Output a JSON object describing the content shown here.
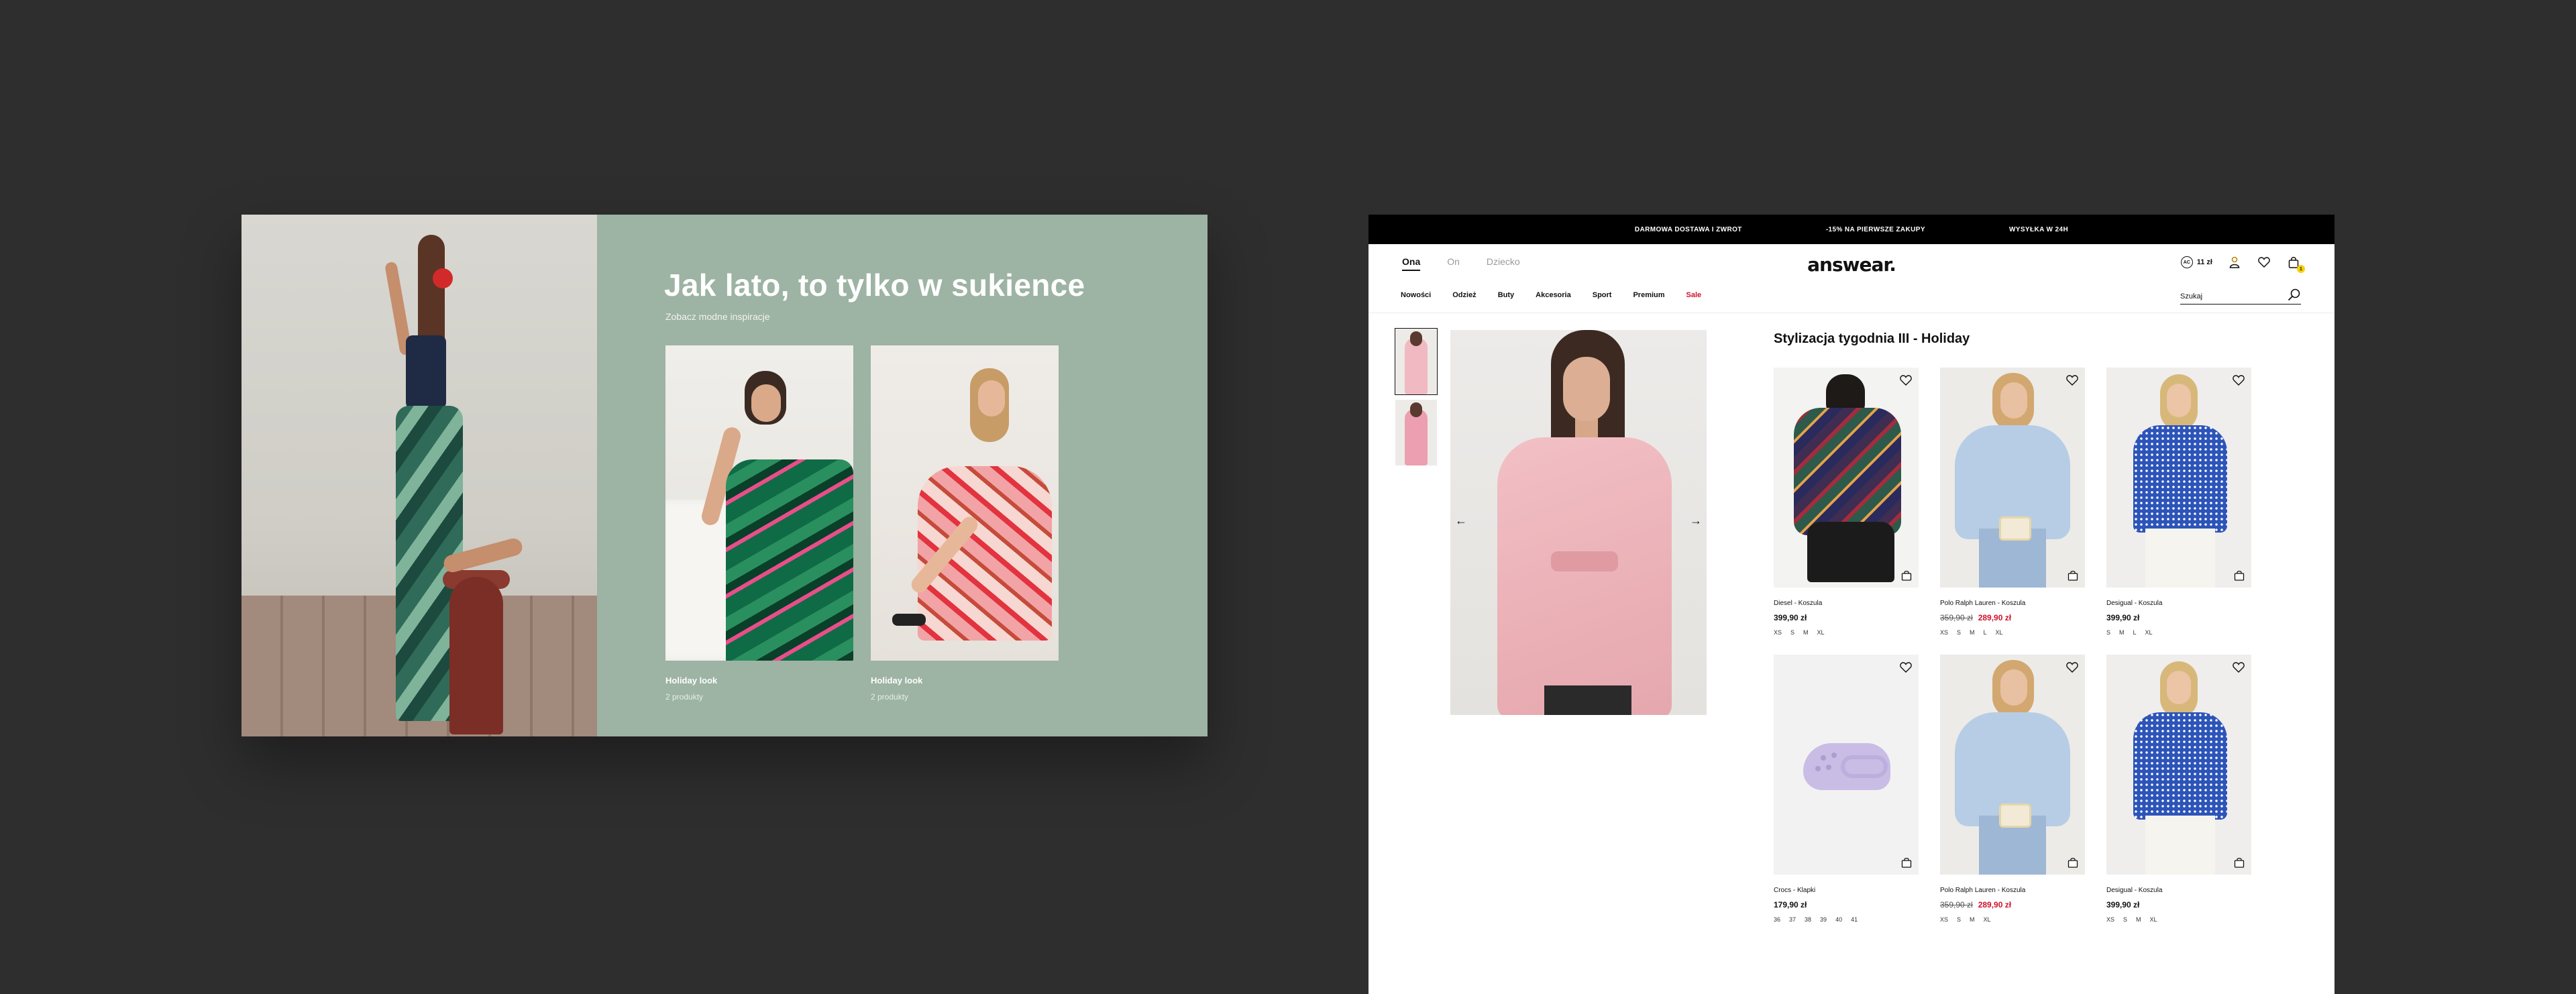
{
  "promo": {
    "title": "Jak lato, to tylko w sukience",
    "subtitle": "Zobacz modne inspiracje",
    "looks": [
      {
        "name": "Holiday look",
        "count": "2 produkty"
      },
      {
        "name": "Holiday look",
        "count": "2 produkty"
      }
    ],
    "background_color": "#9db3a3"
  },
  "shop": {
    "topbar": [
      "DARMOWA DOSTAWA I ZWROT",
      "-15% NA PIERWSZE ZAKUPY",
      "WYSYŁKA W 24H"
    ],
    "gender_tabs": [
      "Ona",
      "On",
      "Dziecko"
    ],
    "active_gender": "Ona",
    "logo": "answear.",
    "points": {
      "badge": "AC",
      "value": "11 zł"
    },
    "cart_count": "1",
    "nav": [
      "Nowości",
      "Odzież",
      "Buty",
      "Akcesoria",
      "Sport",
      "Premium",
      "Sale"
    ],
    "search": {
      "placeholder": "Szukaj"
    },
    "section_title": "Stylizacja tygodnia III - Holiday",
    "products": [
      {
        "brand": "Diesel - Koszula",
        "price": "399,90 zł",
        "old_price": "",
        "sizes": [
          "XS",
          "S",
          "M",
          "XL"
        ]
      },
      {
        "brand": "Polo Ralph Lauren - Koszula",
        "price": "289,90 zł",
        "old_price": "359,90 zł",
        "sizes": [
          "XS",
          "S",
          "M",
          "L",
          "XL"
        ]
      },
      {
        "brand": "Desigual - Koszula",
        "price": "399,90 zł",
        "old_price": "",
        "sizes": [
          "S",
          "M",
          "L",
          "XL"
        ]
      },
      {
        "brand": "Crocs - Klapki",
        "price": "179,90 zł",
        "old_price": "",
        "sizes": [
          "36",
          "37",
          "38",
          "39",
          "40",
          "41"
        ]
      },
      {
        "brand": "Polo Ralph Lauren - Koszula",
        "price": "289,90 zł",
        "old_price": "359,90 zł",
        "sizes": [
          "XS",
          "S",
          "M",
          "XL"
        ]
      },
      {
        "brand": "Desigual - Koszula",
        "price": "399,90 zł",
        "old_price": "",
        "sizes": [
          "XS",
          "S",
          "M",
          "XL"
        ]
      }
    ],
    "accent_color": "#d2102a",
    "badge_color": "#f5d20a"
  }
}
